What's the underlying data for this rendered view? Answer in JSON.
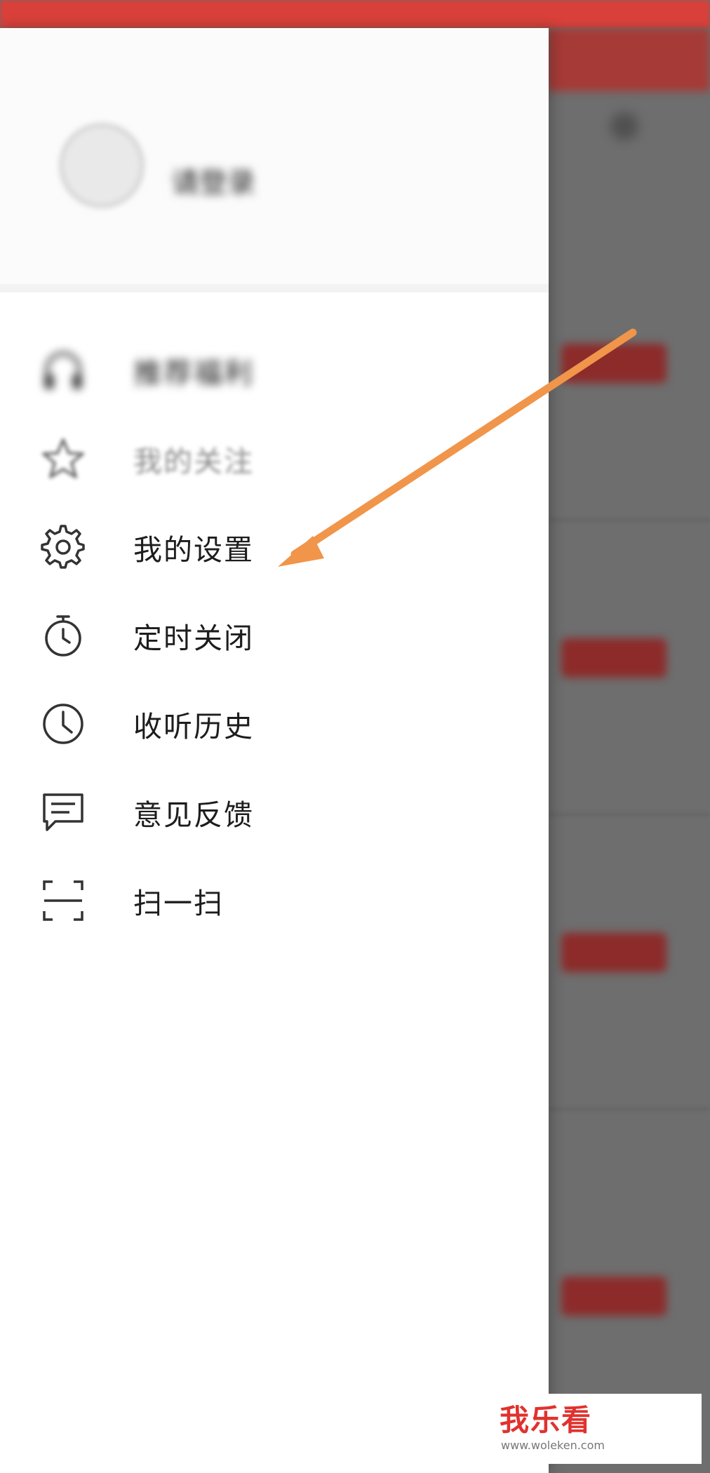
{
  "profile": {
    "username": "请登录"
  },
  "menu": {
    "items": [
      {
        "label": "推荐福利",
        "icon": "headphones-icon"
      },
      {
        "label": "我的关注",
        "icon": "star-icon"
      },
      {
        "label": "我的设置",
        "icon": "gear-icon"
      },
      {
        "label": "定时关闭",
        "icon": "stopwatch-icon"
      },
      {
        "label": "收听历史",
        "icon": "clock-icon"
      },
      {
        "label": "意见反馈",
        "icon": "chat-icon"
      },
      {
        "label": "扫一扫",
        "icon": "scan-icon"
      }
    ]
  },
  "annotation": {
    "arrow_color": "#f0954a"
  },
  "watermark": {
    "text": "我乐看",
    "url": "www.woleken.com"
  },
  "colors": {
    "brand": "#d9403a",
    "text": "#1d1d1d",
    "icon": "#333333"
  }
}
